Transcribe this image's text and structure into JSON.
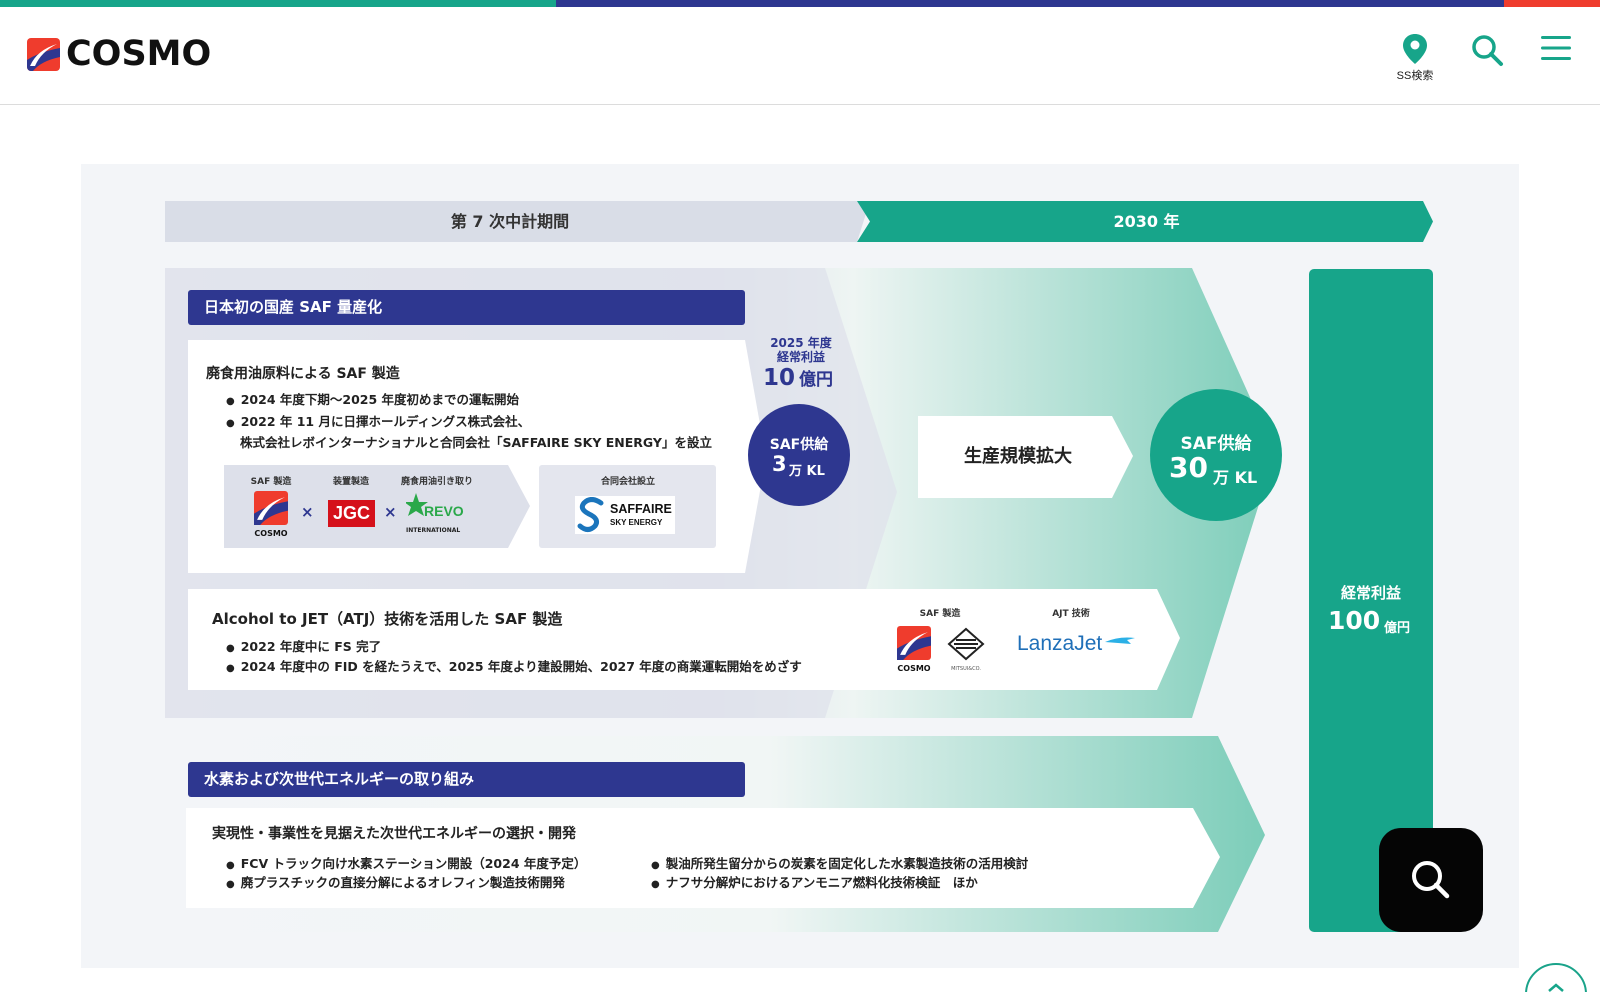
{
  "colors": {
    "brand_green": "#17a58a",
    "brand_navy": "#2e3790",
    "brand_red": "#ef3c2d",
    "panel_bg": "#f3f5f8",
    "period_gray": "#d9dde7"
  },
  "header": {
    "logo_text": "COSMO",
    "ss_search_label": "SS検索",
    "icons": [
      "map-pin-icon",
      "search-icon",
      "menu-icon"
    ]
  },
  "figure": {
    "period_current": "第 7 次中計期間",
    "period_2030": "2030 年",
    "saf": {
      "section_title": "日本初の国産 SAF 量産化",
      "card1_title": "廃食用油原料による SAF 製造",
      "card1_bullet1": "2024 年度下期～2025 年度初めまでの運転開始",
      "card1_bullet2": "2022 年 11 月に日揮ホールディングス株式会社、",
      "card1_bullet2_cont": "株式会社レボインターナショナルと合同会社「SAFFAIRE SKY ENERGY」を設立",
      "partner_label1": "SAF 製造",
      "partner_label2": "装置製造",
      "partner_label3": "廃食用油引き取り",
      "partner_label4": "合同会社設立",
      "logo_cosmo": "COSMO",
      "logo_jgc": "JGC",
      "logo_revo": "REVO",
      "logo_revo_sub": "INTERNATIONAL",
      "times1": "×",
      "times2": "×",
      "saffaire_name": "SAFFAIRE",
      "saffaire_sub": "SKY ENERGY",
      "profit_2025_label1": "2025 年度",
      "profit_2025_label2": "経常利益",
      "profit_2025_value": "10",
      "profit_2025_unit": "億円",
      "supply_2025_label": "SAF供給",
      "supply_2025_value": "3",
      "supply_2025_unit": "万 KL",
      "card2_title": "Alcohol to JET（ATJ）技術を活用した SAF 製造",
      "card2_bullet1": "2022 年度中に FS 完了",
      "card2_bullet2": "2024 年度中の FID を経たうえで、2025 年度より建設開始、2027 年度の商業運転開始をめざす",
      "atj_label1": "SAF 製造",
      "atj_label2": "AJT 技術",
      "logo_mitsui_sub": "MITSUI&CO.",
      "logo_lanzajet": "LanzaJet",
      "expand_label": "生産規模拡大",
      "supply_2030_label": "SAF供給",
      "supply_2030_value": "30",
      "supply_2030_unit": "万 KL"
    },
    "hydrogen": {
      "section_title": "水素および次世代エネルギーの取り組み",
      "card_title": "実現性・事業性を見据えた次世代エネルギーの選択・開発",
      "bullet1": "FCV トラック向け水素ステーション開設（2024 年度予定）",
      "bullet2": "廃プラスチックの直接分解によるオレフィン製造技術開発",
      "bullet3": "製油所発生留分からの炭素を固定化した水素製造技術の活用検討",
      "bullet4": "ナフサ分解炉におけるアンモニア燃料化技術検証　ほか"
    },
    "profit_2030_label": "経常利益",
    "profit_2030_value": "100",
    "profit_2030_unit": "億円"
  },
  "floating": {
    "search_fab": "search-icon",
    "back_to_top": "chevron-up-icon"
  }
}
